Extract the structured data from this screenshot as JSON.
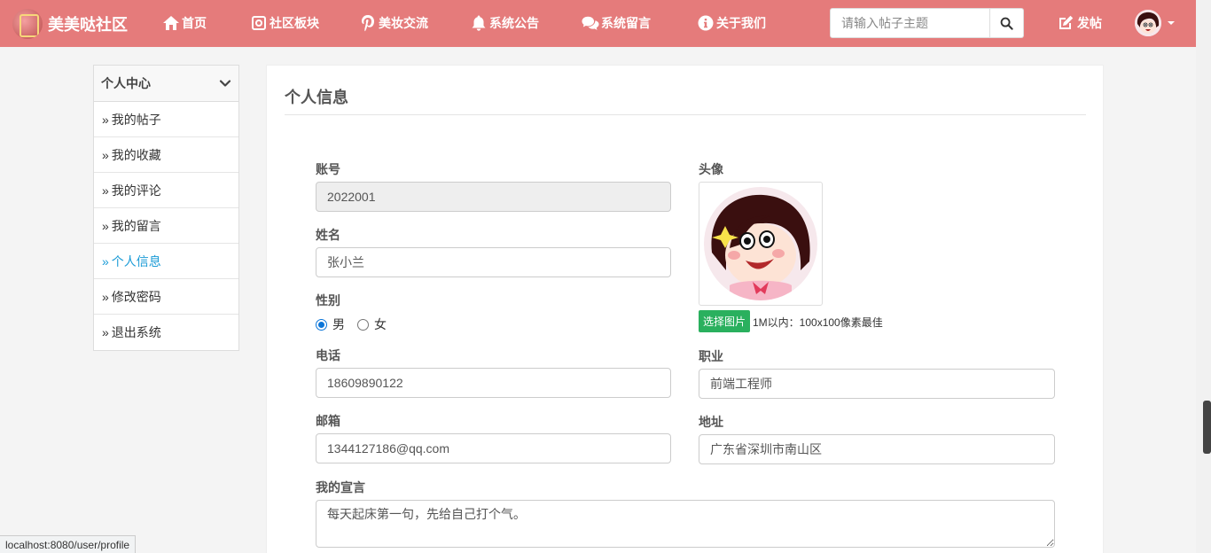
{
  "brand": {
    "name": "美美哒社区"
  },
  "nav": {
    "items": [
      {
        "label": "首页",
        "icon": "home-icon"
      },
      {
        "label": "社区板块",
        "icon": "instagram-icon"
      },
      {
        "label": "美妆交流",
        "icon": "pinterest-icon"
      },
      {
        "label": "系统公告",
        "icon": "bell-icon"
      },
      {
        "label": "系统留言",
        "icon": "comments-icon"
      },
      {
        "label": "关于我们",
        "icon": "info-icon"
      }
    ],
    "search_placeholder": "请输入帖子主题",
    "post_label": "发帖"
  },
  "sidebar": {
    "title": "个人中心",
    "items": [
      {
        "label": "我的帖子"
      },
      {
        "label": "我的收藏"
      },
      {
        "label": "我的评论"
      },
      {
        "label": "我的留言"
      },
      {
        "label": "个人信息",
        "active": true
      },
      {
        "label": "修改密码"
      },
      {
        "label": "退出系统"
      }
    ]
  },
  "profile": {
    "title": "个人信息",
    "account_label": "账号",
    "account_value": "2022001",
    "name_label": "姓名",
    "name_value": "张小兰",
    "gender_label": "性别",
    "gender_male": "男",
    "gender_female": "女",
    "gender_selected": "男",
    "phone_label": "电话",
    "phone_value": "18609890122",
    "email_label": "邮箱",
    "email_value": "1344127186@qq.com",
    "avatar_label": "头像",
    "choose_image": "选择图片",
    "upload_hint": "1M以内：100x100像素最佳",
    "job_label": "职业",
    "job_value": "前端工程师",
    "address_label": "地址",
    "address_value": "广东省深圳市南山区",
    "motto_label": "我的宣言",
    "motto_value": "每天起床第一句，先给自己打个气。"
  },
  "statusbar": {
    "url": "localhost:8080/user/profile"
  },
  "colors": {
    "navbar": "#e57b7b",
    "active_link": "#1a9bd6",
    "upload_button": "#2ab05e"
  }
}
